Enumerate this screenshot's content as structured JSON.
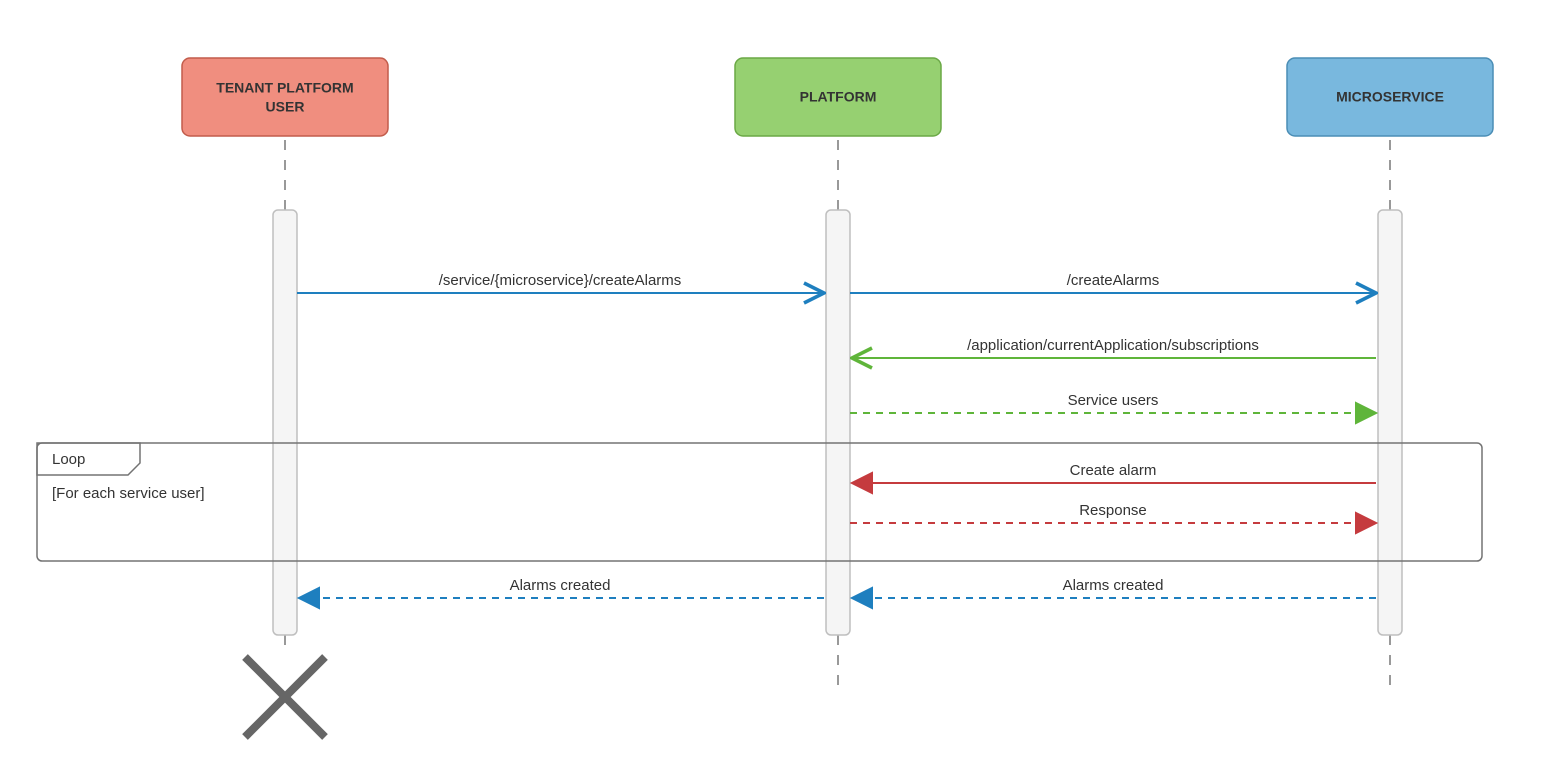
{
  "actors": {
    "tenant_user": {
      "line1": "TENANT PLATFORM",
      "line2": "USER",
      "fill": "#f08e7f",
      "stroke": "#c25c4b"
    },
    "platform": {
      "label": "PLATFORM",
      "fill": "#96d071",
      "stroke": "#6aa845"
    },
    "microservice": {
      "label": "MICROSERVICE",
      "fill": "#79b8de",
      "stroke": "#4a8db5"
    }
  },
  "messages": {
    "m1": "/service/{microservice}/createAlarms",
    "m2": "/createAlarms",
    "m3": "/application/currentApplication/subscriptions",
    "m4": "Service users",
    "m5": "Create alarm",
    "m6": "Response",
    "m7": "Alarms created",
    "m8": "Alarms created"
  },
  "fragment": {
    "title": "Loop",
    "guard": "[For each service user]"
  },
  "colors": {
    "blue": "#1e7fbf",
    "green": "#5fb53a",
    "red": "#c53b3e"
  }
}
